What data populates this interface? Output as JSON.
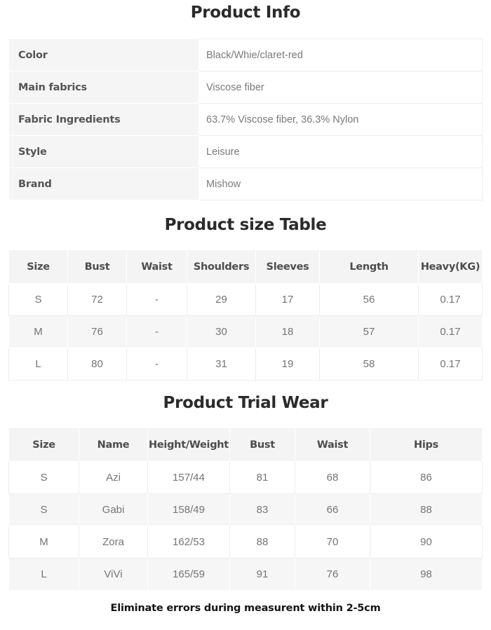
{
  "sections": {
    "product_info": {
      "title": "Product Info",
      "rows": [
        {
          "label": "Color",
          "value": "Black/Whie/claret-red"
        },
        {
          "label": "Main fabrics",
          "value": "Viscose fiber"
        },
        {
          "label": "Fabric Ingredients",
          "value": "63.7% Viscose fiber, 36.3% Nylon"
        },
        {
          "label": "Style",
          "value": "Leisure"
        },
        {
          "label": "Brand",
          "value": "Mishow"
        }
      ]
    },
    "size_table": {
      "title": "Product size Table",
      "headers": [
        "Size",
        "Bust",
        "Waist",
        "Shoulders",
        "Sleeves",
        "Length",
        "Heavy(KG)"
      ],
      "rows": [
        [
          "S",
          "72",
          "-",
          "29",
          "17",
          "56",
          "0.17"
        ],
        [
          "M",
          "76",
          "-",
          "30",
          "18",
          "57",
          "0.17"
        ],
        [
          "L",
          "80",
          "-",
          "31",
          "19",
          "58",
          "0.17"
        ]
      ]
    },
    "trial_wear": {
      "title": "Product Trial Wear",
      "headers": [
        "Size",
        "Name",
        "Height/Weight",
        "Bust",
        "Waist",
        "Hips"
      ],
      "rows": [
        [
          "S",
          "Azi",
          "157/44",
          "81",
          "68",
          "86"
        ],
        [
          "S",
          "Gabi",
          "158/49",
          "83",
          "66",
          "88"
        ],
        [
          "M",
          "Zora",
          "162/53",
          "88",
          "70",
          "90"
        ],
        [
          "L",
          "ViVi",
          "165/59",
          "91",
          "76",
          "98"
        ]
      ]
    }
  },
  "footer": {
    "note": "Eliminate errors during measurent within 2-5cm"
  },
  "colors": {
    "page_background": "#ffffff",
    "header_cell_background": "#f4f4f4",
    "stripe_background": "#f6f6f6",
    "cell_border": "#ececec",
    "heading_text": "#2b2b2b",
    "label_text": "#555555",
    "value_text": "#7a7a7a",
    "note_text": "#151515"
  }
}
